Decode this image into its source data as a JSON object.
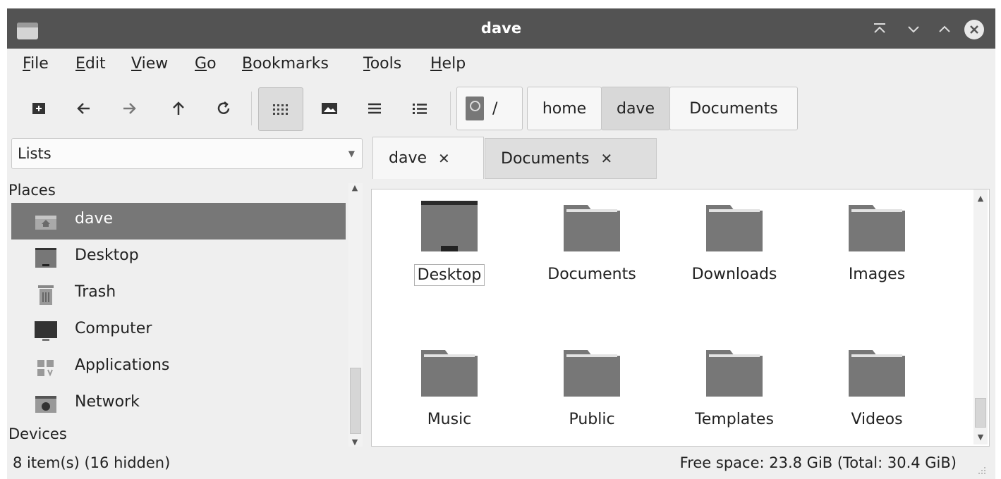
{
  "window": {
    "title": "dave"
  },
  "menu": {
    "items": [
      {
        "pre": "",
        "key": "F",
        "rest": "ile"
      },
      {
        "pre": "",
        "key": "E",
        "rest": "dit"
      },
      {
        "pre": "",
        "key": "V",
        "rest": "iew"
      },
      {
        "pre": "",
        "key": "G",
        "rest": "o"
      },
      {
        "pre": "",
        "key": "B",
        "rest": "ookmarks"
      },
      {
        "pre": "",
        "key": "T",
        "rest": "ools"
      },
      {
        "pre": "",
        "key": "H",
        "rest": "elp"
      }
    ]
  },
  "toolbar": {
    "icons": [
      "new-tab-icon",
      "back-icon",
      "forward-icon",
      "up-icon",
      "reload-icon",
      "icon-view-icon",
      "thumbnail-view-icon",
      "compact-view-icon",
      "detailed-list-icon"
    ]
  },
  "pathbar": {
    "root": "/",
    "crumbs": [
      "home",
      "dave",
      "Documents"
    ],
    "selected": "dave"
  },
  "sidebar": {
    "mode": "Lists",
    "sections": [
      {
        "heading": "Places",
        "items": [
          {
            "label": "dave",
            "icon": "home-folder-icon",
            "selected": true
          },
          {
            "label": "Desktop",
            "icon": "desktop-icon",
            "selected": false
          },
          {
            "label": "Trash",
            "icon": "trash-icon",
            "selected": false
          },
          {
            "label": "Computer",
            "icon": "computer-icon",
            "selected": false
          },
          {
            "label": "Applications",
            "icon": "applications-icon",
            "selected": false
          },
          {
            "label": "Network",
            "icon": "network-icon",
            "selected": false
          }
        ]
      },
      {
        "heading": "Devices",
        "items": []
      }
    ]
  },
  "tabs": [
    {
      "label": "dave",
      "close": "✕",
      "active": true
    },
    {
      "label": "Documents",
      "close": "✕",
      "active": false
    }
  ],
  "files": [
    {
      "name": "Desktop",
      "icon": "desktop-folder-icon",
      "focused": true
    },
    {
      "name": "Documents",
      "icon": "folder-icon",
      "focused": false
    },
    {
      "name": "Downloads",
      "icon": "folder-icon",
      "focused": false
    },
    {
      "name": "Images",
      "icon": "folder-icon",
      "focused": false
    },
    {
      "name": "Music",
      "icon": "folder-icon",
      "focused": false
    },
    {
      "name": "Public",
      "icon": "folder-icon",
      "focused": false
    },
    {
      "name": "Templates",
      "icon": "folder-icon",
      "focused": false
    },
    {
      "name": "Videos",
      "icon": "folder-icon",
      "focused": false
    }
  ],
  "status": {
    "left": "8 item(s) (16 hidden)",
    "right": "Free space: 23.8 GiB (Total: 30.4 GiB)"
  }
}
